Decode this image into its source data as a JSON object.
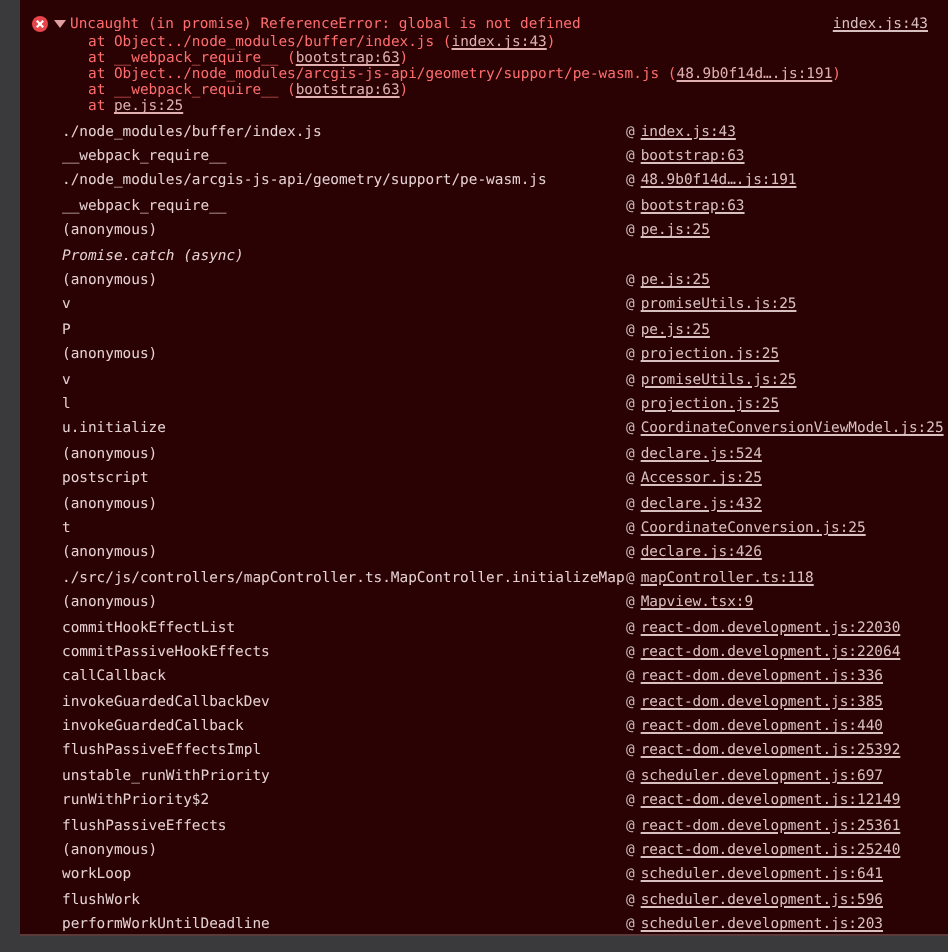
{
  "error": {
    "expanded": true,
    "message": "Uncaught (in promise) ReferenceError: global is not defined",
    "source": "index.js:43",
    "stack": [
      {
        "text": "at Object../node_modules/buffer/index.js (",
        "link": "index.js:43",
        "close": ")"
      },
      {
        "text": "at __webpack_require__ (",
        "link": "bootstrap:63",
        "close": ")"
      },
      {
        "text": "at Object../node_modules/arcgis-js-api/geometry/support/pe-wasm.js (",
        "link": "48.9b0f14d….js:191",
        "close": ")"
      },
      {
        "text": "at __webpack_require__ (",
        "link": "bootstrap:63",
        "close": ")"
      },
      {
        "text": "at ",
        "link": "pe.js:25"
      }
    ]
  },
  "call_stack": [
    {
      "kind": "frame",
      "function": "./node_modules/buffer/index.js",
      "at": "@",
      "location": "index.js:43"
    },
    {
      "kind": "frame",
      "function": "__webpack_require__",
      "at": "@",
      "location": "bootstrap:63"
    },
    {
      "kind": "frame",
      "function": "./node_modules/arcgis-js-api/geometry/support/pe-wasm.js",
      "at": "@",
      "location": "48.9b0f14d….js:191"
    },
    {
      "kind": "frame",
      "function": "__webpack_require__",
      "at": "@",
      "location": "bootstrap:63"
    },
    {
      "kind": "frame",
      "function": "(anonymous)",
      "at": "@",
      "location": "pe.js:25"
    },
    {
      "kind": "async",
      "function": "Promise.catch (async)"
    },
    {
      "kind": "frame",
      "function": "(anonymous)",
      "at": "@",
      "location": "pe.js:25"
    },
    {
      "kind": "frame",
      "function": "v",
      "at": "@",
      "location": "promiseUtils.js:25"
    },
    {
      "kind": "frame",
      "function": "P",
      "at": "@",
      "location": "pe.js:25"
    },
    {
      "kind": "frame",
      "function": "(anonymous)",
      "at": "@",
      "location": "projection.js:25"
    },
    {
      "kind": "frame",
      "function": "v",
      "at": "@",
      "location": "promiseUtils.js:25"
    },
    {
      "kind": "frame",
      "function": "l",
      "at": "@",
      "location": "projection.js:25"
    },
    {
      "kind": "frame",
      "function": "u.initialize",
      "at": "@",
      "location": "CoordinateConversionViewModel.js:25"
    },
    {
      "kind": "frame",
      "function": "(anonymous)",
      "at": "@",
      "location": "declare.js:524"
    },
    {
      "kind": "frame",
      "function": "postscript",
      "at": "@",
      "location": "Accessor.js:25"
    },
    {
      "kind": "frame",
      "function": "(anonymous)",
      "at": "@",
      "location": "declare.js:432"
    },
    {
      "kind": "frame",
      "function": "t",
      "at": "@",
      "location": "CoordinateConversion.js:25"
    },
    {
      "kind": "frame",
      "function": "(anonymous)",
      "at": "@",
      "location": "declare.js:426"
    },
    {
      "kind": "frame",
      "function": "./src/js/controllers/mapController.ts.MapController.initializeMap",
      "at": "@",
      "location": "mapController.ts:118"
    },
    {
      "kind": "frame",
      "function": "(anonymous)",
      "at": "@",
      "location": "Mapview.tsx:9"
    },
    {
      "kind": "frame",
      "function": "commitHookEffectList",
      "at": "@",
      "location": "react-dom.development.js:22030"
    },
    {
      "kind": "frame",
      "function": "commitPassiveHookEffects",
      "at": "@",
      "location": "react-dom.development.js:22064"
    },
    {
      "kind": "frame",
      "function": "callCallback",
      "at": "@",
      "location": "react-dom.development.js:336"
    },
    {
      "kind": "frame",
      "function": "invokeGuardedCallbackDev",
      "at": "@",
      "location": "react-dom.development.js:385"
    },
    {
      "kind": "frame",
      "function": "invokeGuardedCallback",
      "at": "@",
      "location": "react-dom.development.js:440"
    },
    {
      "kind": "frame",
      "function": "flushPassiveEffectsImpl",
      "at": "@",
      "location": "react-dom.development.js:25392"
    },
    {
      "kind": "frame",
      "function": "unstable_runWithPriority",
      "at": "@",
      "location": "scheduler.development.js:697"
    },
    {
      "kind": "frame",
      "function": "runWithPriority$2",
      "at": "@",
      "location": "react-dom.development.js:12149"
    },
    {
      "kind": "frame",
      "function": "flushPassiveEffects",
      "at": "@",
      "location": "react-dom.development.js:25361"
    },
    {
      "kind": "frame",
      "function": "(anonymous)",
      "at": "@",
      "location": "react-dom.development.js:25240"
    },
    {
      "kind": "frame",
      "function": "workLoop",
      "at": "@",
      "location": "scheduler.development.js:641"
    },
    {
      "kind": "frame",
      "function": "flushWork",
      "at": "@",
      "location": "scheduler.development.js:596"
    },
    {
      "kind": "frame",
      "function": "performWorkUntilDeadline",
      "at": "@",
      "location": "scheduler.development.js:203"
    }
  ]
}
